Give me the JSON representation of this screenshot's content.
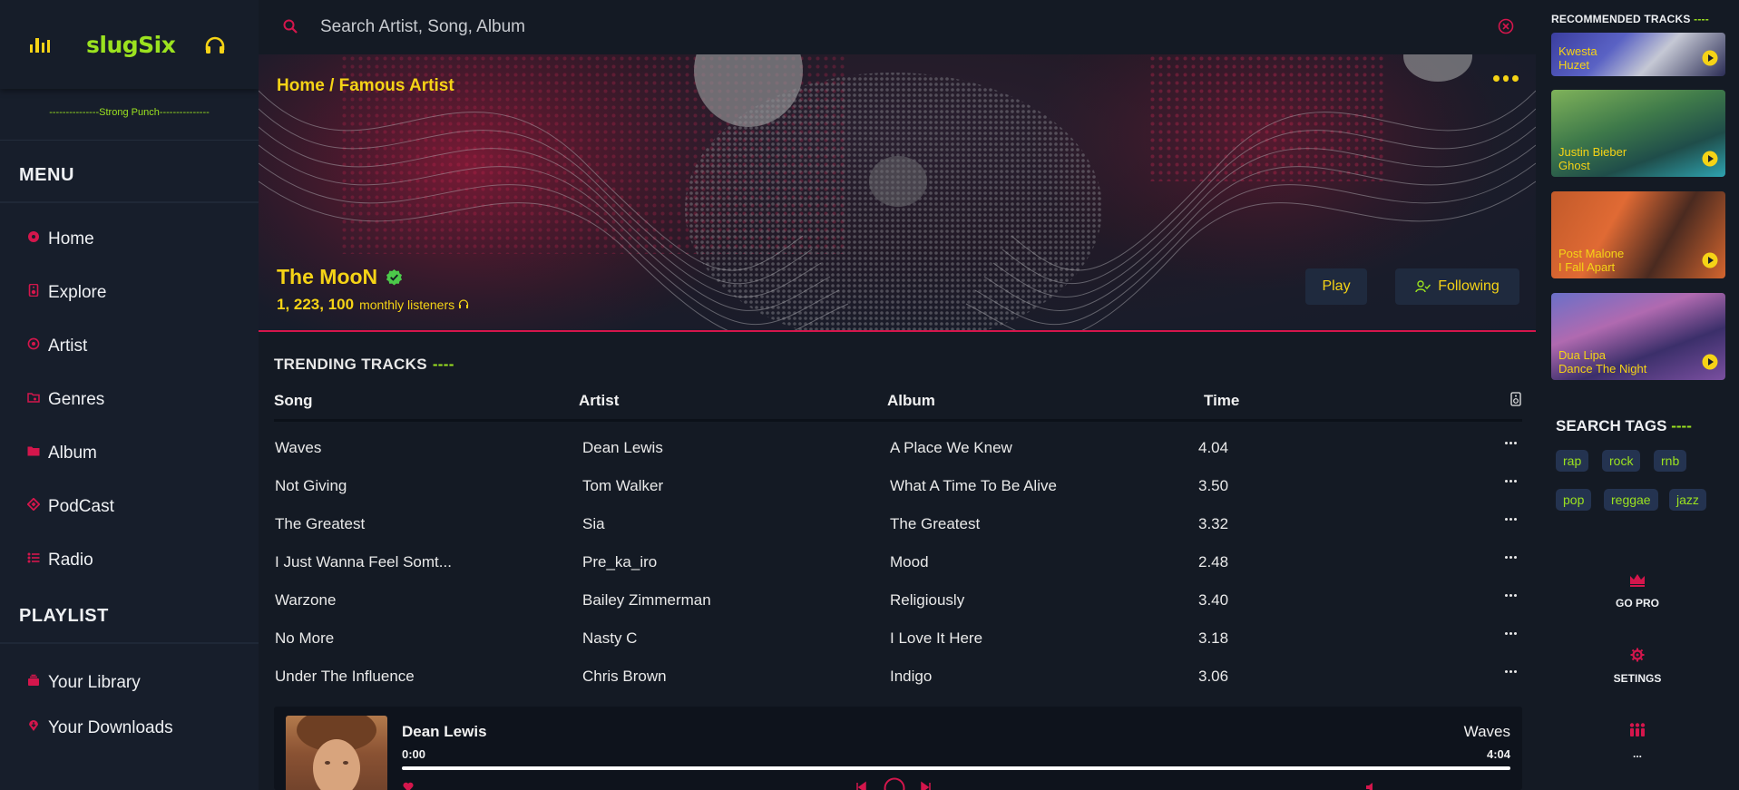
{
  "brand": {
    "name": "slugSix",
    "tagline": "---------------Strong Punch---------------"
  },
  "sidebar": {
    "menu_title": "MENU",
    "menu_items": [
      {
        "label": "Home",
        "icon": "disc-icon"
      },
      {
        "label": "Explore",
        "icon": "speaker-icon"
      },
      {
        "label": "Artist",
        "icon": "record-icon"
      },
      {
        "label": "Genres",
        "icon": "folder-music-icon"
      },
      {
        "label": "Album",
        "icon": "folder-icon"
      },
      {
        "label": "PodCast",
        "icon": "diamond-icon"
      },
      {
        "label": "Radio",
        "icon": "list-icon"
      }
    ],
    "playlist_title": "PLAYLIST",
    "playlist_items": [
      {
        "label": "Your Library",
        "icon": "library-icon"
      },
      {
        "label": "Your Downloads",
        "icon": "download-icon"
      }
    ]
  },
  "search": {
    "placeholder": "Search Artist, Song, Album"
  },
  "hero": {
    "breadcrumb": "Home / Famous Artist",
    "artist": "The MooN",
    "listeners_count": "1, 223, 100",
    "listeners_label": "monthly listeners",
    "play_label": "Play",
    "following_label": "Following"
  },
  "trending": {
    "title": "TRENDING TRACKS",
    "title_dash": "----",
    "headers": {
      "song": "Song",
      "artist": "Artist",
      "album": "Album",
      "time": "Time"
    },
    "rows": [
      {
        "song": "Waves",
        "artist": "Dean Lewis",
        "album": "A Place We Knew",
        "time": "4.04"
      },
      {
        "song": "Not Giving",
        "artist": "Tom Walker",
        "album": "What A Time To Be Alive",
        "time": "3.50"
      },
      {
        "song": "The Greatest",
        "artist": "Sia",
        "album": "The Greatest",
        "time": "3.32"
      },
      {
        "song": "I Just Wanna Feel Somt...",
        "artist": "Pre_ka_iro",
        "album": "Mood",
        "time": "2.48"
      },
      {
        "song": "Warzone",
        "artist": "Bailey Zimmerman",
        "album": "Religiously",
        "time": "3.40"
      },
      {
        "song": "No More",
        "artist": "Nasty C",
        "album": "I Love It Here",
        "time": "3.18"
      },
      {
        "song": "Under The Influence",
        "artist": "Chris Brown",
        "album": "Indigo",
        "time": "3.06"
      }
    ]
  },
  "player": {
    "artist": "Dean Lewis",
    "song": "Waves",
    "current_time": "0:00",
    "duration": "4:04",
    "progress": 0
  },
  "recommended": {
    "title": "RECOMMENDED TRACKS",
    "title_dash": "----",
    "tracks": [
      {
        "artist": "Kwesta",
        "song": "Huzet"
      },
      {
        "artist": "Justin Bieber",
        "song": "Ghost"
      },
      {
        "artist": "Post Malone",
        "song": "I Fall Apart"
      },
      {
        "artist": "Dua Lipa",
        "song": "Dance The Night"
      }
    ]
  },
  "tags": {
    "title": "SEARCH TAGS",
    "title_dash": "----",
    "items": [
      "rap",
      "rock",
      "rnb",
      "pop",
      "reggae",
      "jazz"
    ]
  },
  "right_nav": [
    {
      "label": "GO PRO",
      "icon": "crown-icon"
    },
    {
      "label": "SETINGS",
      "icon": "settings-icon"
    },
    {
      "label": "...",
      "icon": "users-icon"
    }
  ],
  "colors": {
    "accent": "#d4164c",
    "yellow": "#f5d316",
    "green": "#9be21f",
    "background": "#141a24"
  }
}
